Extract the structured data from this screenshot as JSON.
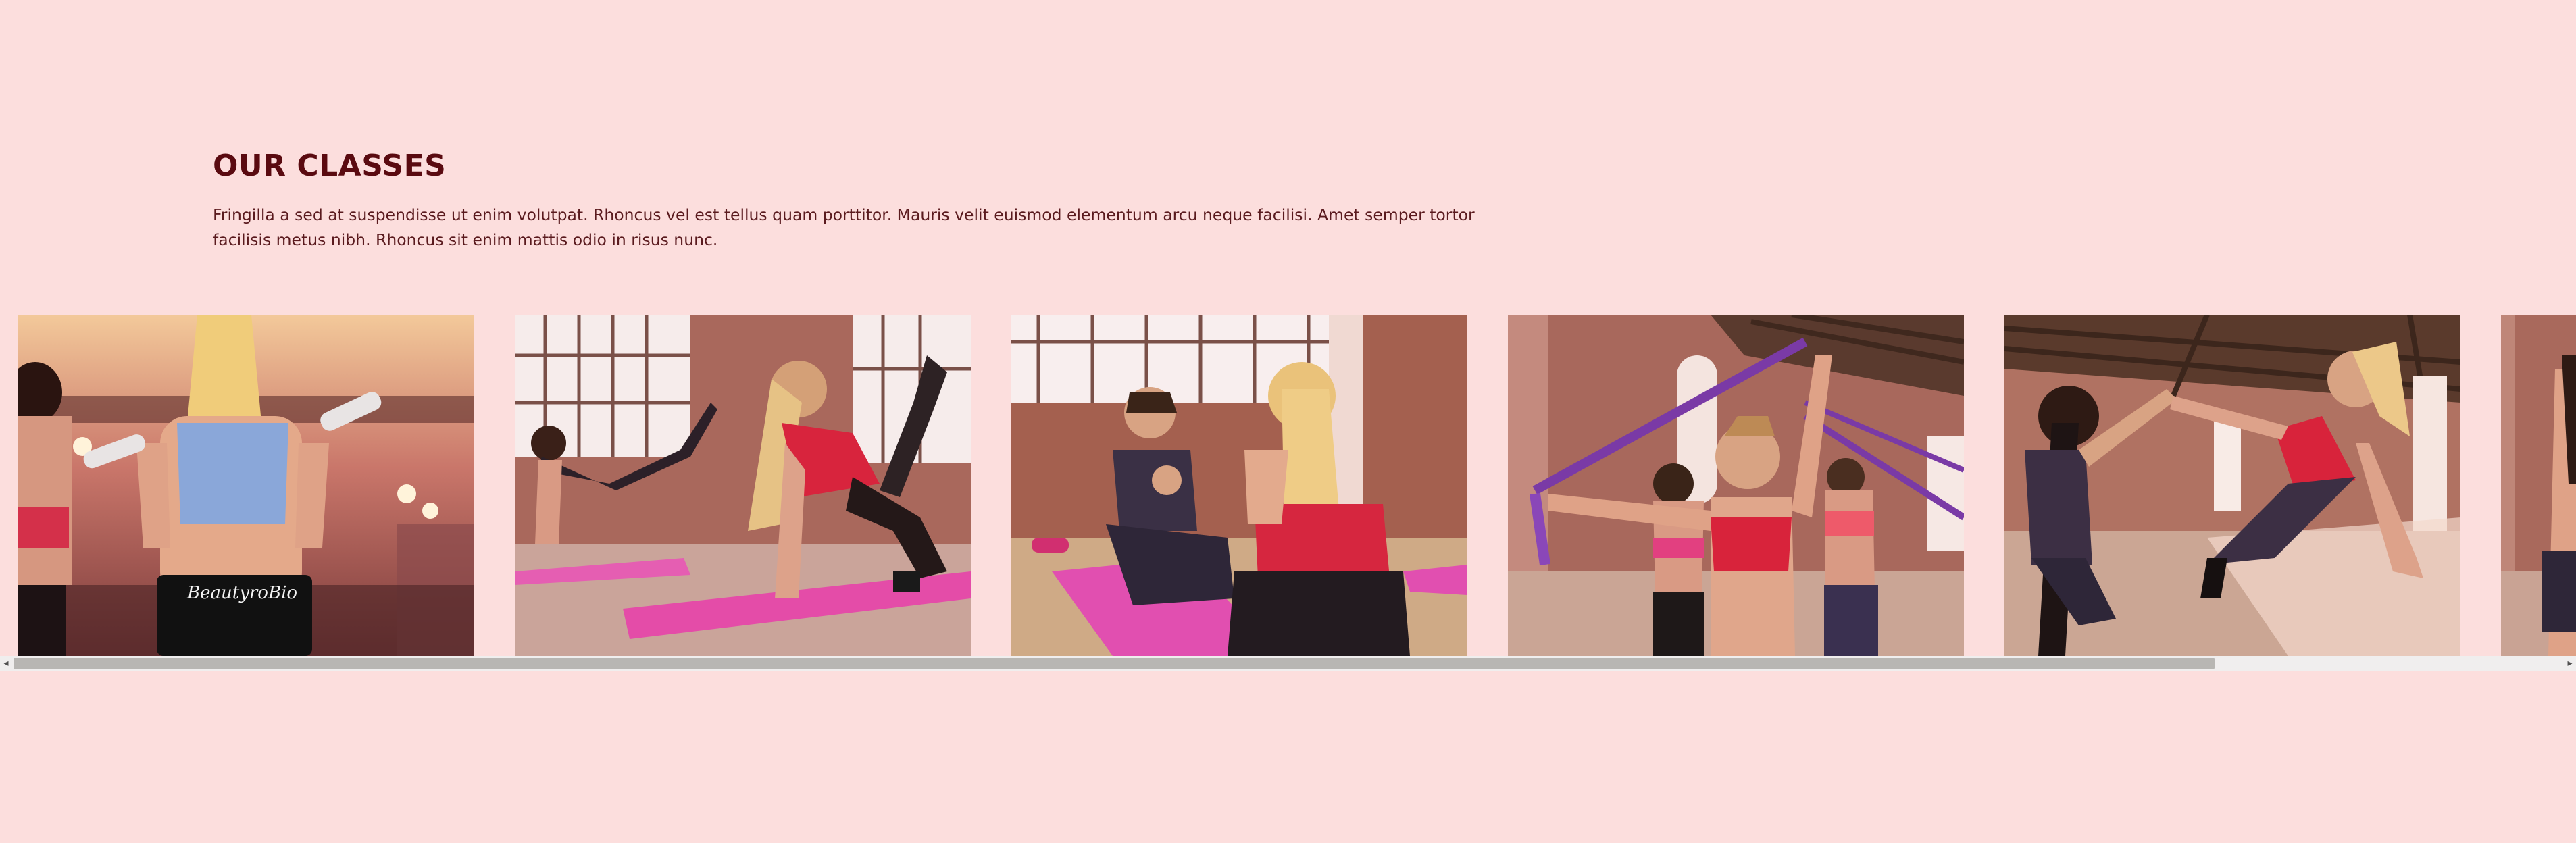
{
  "section": {
    "title": "OUR CLASSES",
    "description": "Fringilla a sed at suspendisse ut enim volutpat. Rhoncus vel est tellus quam porttitor. Mauris velit euismod elementum arcu neque facilisi. Amet semper tortor facilisis metus nibh. Rhoncus sit enim mattis odio in risus nunc."
  },
  "gallery": {
    "images": [
      {
        "subject": "women-lifting-dumbbells-gym",
        "shirt_text": "BeautyroBio"
      },
      {
        "subject": "women-on-mats-leg-raise"
      },
      {
        "subject": "women-sitting-on-mat-talking"
      },
      {
        "subject": "women-stretching-resistance-bands"
      },
      {
        "subject": "women-high-five-plank"
      },
      {
        "subject": "woman-partial-edge"
      }
    ]
  },
  "scrollbar": {
    "left_arrow": "◂",
    "right_arrow": "▸"
  },
  "colors": {
    "background": "#fcdedd",
    "heading": "#5a0a10",
    "text": "#5a1a1e",
    "scroll_track": "#f0eeee",
    "scroll_thumb": "#b8b6b3"
  }
}
